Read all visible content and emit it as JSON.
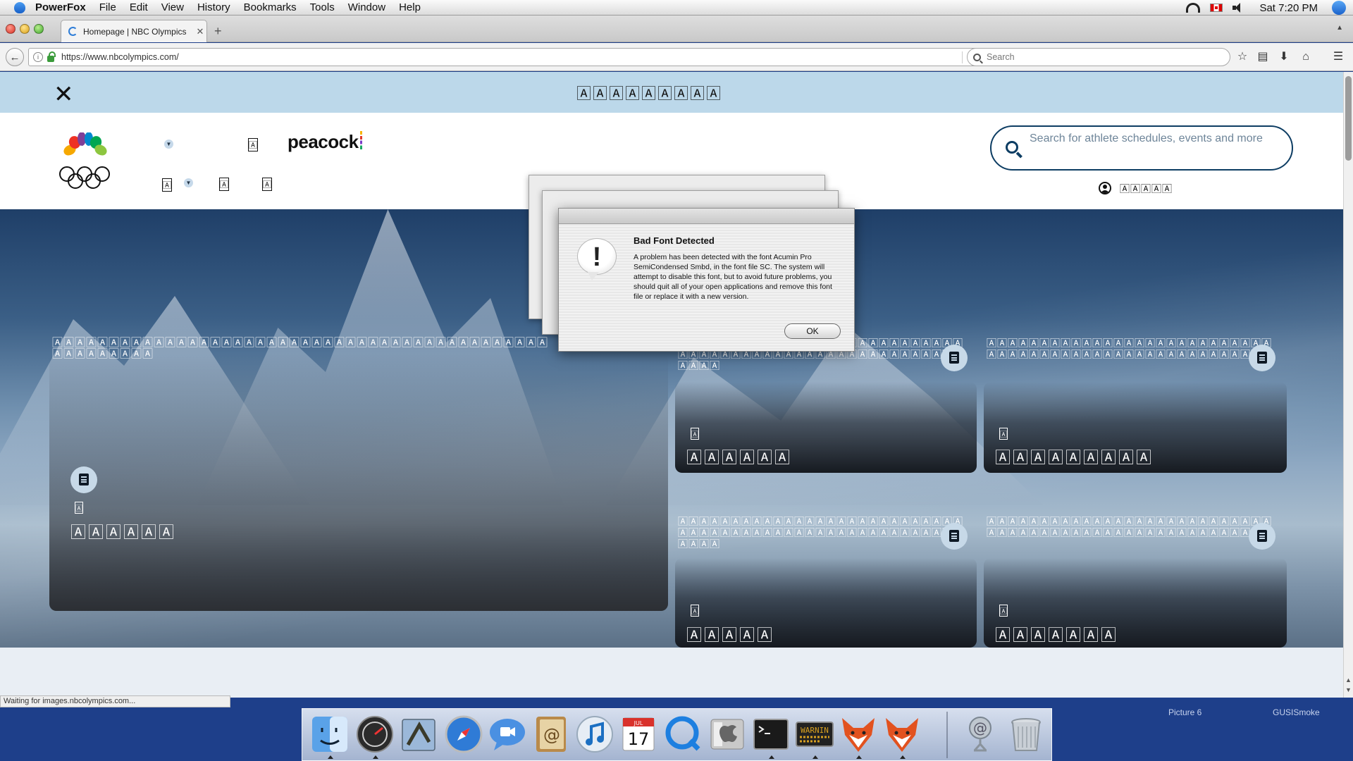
{
  "menubar": {
    "app_name": "PowerFox",
    "items": [
      "File",
      "Edit",
      "View",
      "History",
      "Bookmarks",
      "Tools",
      "Window",
      "Help"
    ],
    "clock": "Sat 7:20 PM"
  },
  "browser": {
    "tab_title": "Homepage | NBC Olympics",
    "url": "https://www.nbcolympics.com/",
    "search_placeholder": "Search",
    "status": "Waiting for images.nbcolympics.com..."
  },
  "promo_banner": {
    "text": "🄰🄰🄰🄰🄰🄰🄰🄰🄰"
  },
  "header": {
    "nav_glyph": "🄰",
    "peacock_logo": "peacock",
    "search_placeholder": "Search for athlete schedules, events and more",
    "account_label": "🄰🄰🄰🄰🄰"
  },
  "hero": {
    "headline": "🄰🄰🄰🄰🄰🄰🄰🄰🄰🄰🄰🄰🄰🄰🄰🄰🄰🄰🄰🄰🄰🄰🄰🄰🄰🄰🄰🄰🄰🄰🄰🄰🄰🄰🄰🄰🄰🄰🄰🄰🄰🄰🄰🄰🄰🄰🄰🄰🄰🄰🄰🄰🄰",
    "tag": "🄰",
    "title": "🄰🄰🄰🄰🄰🄰"
  },
  "cards": [
    {
      "headline": "🄰🄰🄰🄰🄰🄰🄰🄰🄰🄰🄰🄰🄰🄰🄰🄰🄰🄰🄰🄰🄰🄰🄰🄰🄰🄰🄰🄰🄰🄰🄰🄰🄰🄰🄰🄰🄰🄰🄰🄰🄰🄰🄰🄰🄰🄰🄰🄰🄰🄰🄰🄰🄰🄰🄰🄰🄰🄰",
      "tag": "🄰",
      "title": "🄰🄰🄰🄰🄰🄰"
    },
    {
      "headline": "🄰🄰🄰🄰🄰🄰🄰🄰🄰🄰🄰🄰🄰🄰🄰🄰🄰🄰🄰🄰🄰🄰🄰🄰🄰🄰🄰🄰🄰🄰🄰🄰🄰🄰🄰🄰🄰🄰🄰🄰🄰🄰🄰🄰🄰🄰🄰🄰🄰🄰🄰🄰🄰",
      "tag": "🄰",
      "title": "🄰🄰🄰🄰🄰🄰🄰🄰🄰"
    },
    {
      "headline": "🄰🄰🄰🄰🄰🄰🄰🄰🄰🄰🄰🄰🄰🄰🄰🄰🄰🄰🄰🄰🄰🄰🄰🄰🄰🄰🄰🄰🄰🄰🄰🄰🄰🄰🄰🄰🄰🄰🄰🄰🄰🄰🄰🄰🄰🄰🄰🄰🄰🄰🄰🄰🄰🄰🄰🄰🄰🄰",
      "tag": "🄰",
      "title": "🄰🄰🄰🄰🄰"
    },
    {
      "headline": "🄰🄰🄰🄰🄰🄰🄰🄰🄰🄰🄰🄰🄰🄰🄰🄰🄰🄰🄰🄰🄰🄰🄰🄰🄰🄰🄰🄰🄰🄰🄰🄰🄰🄰🄰🄰🄰🄰🄰🄰🄰🄰🄰🄰🄰🄰🄰🄰🄰🄰🄰🄰",
      "tag": "🄰",
      "title": "🄰🄰🄰🄰🄰🄰🄰"
    }
  ],
  "alert": {
    "title": "Bad Font Detected",
    "message": "A problem has been detected with the font Acumin Pro SemiCondensed Smbd, in the font file SC. The system will attempt to disable this font, but to avoid future problems, you should quit all of your open applications and remove this font file or replace it with a new version.",
    "ok_label": "OK"
  },
  "desktop": {
    "label_1": "Picture 6",
    "label_2": "GUSISmoke"
  },
  "dock": {
    "items": [
      "finder-icon",
      "dashboard-icon",
      "mail-icon",
      "safari-icon",
      "ichat-icon",
      "address-book-icon",
      "itunes-icon",
      "ical-icon",
      "quicktime-icon",
      "system-prefs-icon",
      "terminal-icon",
      "console-icon",
      "powerfox-icon",
      "powerfox-icon",
      "downloads-icon",
      "trash-icon"
    ],
    "ical_day": "17",
    "ical_month": "JUL",
    "console_text": "WARNIN"
  },
  "colors": {
    "promo_bg": "#bcd8ea",
    "nbc_navy": "#0d3d63",
    "desktop_blue": "#1e3f8a"
  }
}
